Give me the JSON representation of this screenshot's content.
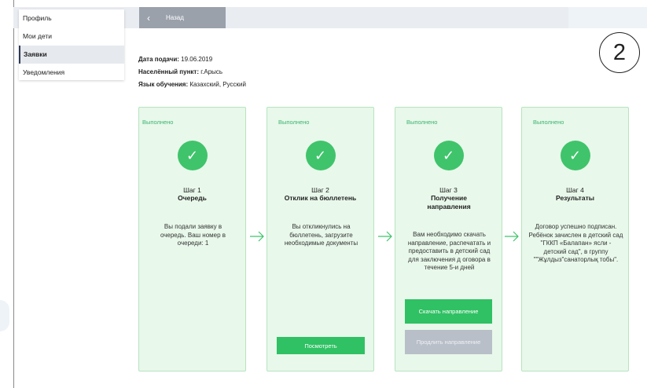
{
  "sidebar": {
    "items": [
      {
        "label": "Профиль"
      },
      {
        "label": "Мои дети"
      },
      {
        "label": "Заявки"
      },
      {
        "label": "Уведомления"
      }
    ]
  },
  "header": {
    "back_label": "Назад",
    "step_badge": "2"
  },
  "application": {
    "date_label": "Дата подачи:",
    "date_value": "19.06.2019",
    "locality_label": "Населённый пункт:",
    "locality_value": "г.Арысь",
    "language_label": "Язык обучения:",
    "language_value": "Казахский, Русский"
  },
  "steps": [
    {
      "status": "Выполнено",
      "number": "Шаг 1",
      "title": "Очередь",
      "description": "Вы подали заявку в очередь. Ваш номер в очереди: 1"
    },
    {
      "status": "Выполнено",
      "number": "Шаг 2",
      "title": "Отклик на бюллетень",
      "description": "Вы откликнулись на бюллетень, загрузите необходимые документы",
      "button": "Посмотреть"
    },
    {
      "status": "Выполнено",
      "number": "Шаг 3",
      "title": "Получение направления",
      "description": "Вам необходимо скачать направление, распечатать и предоставить в детский сад для заключения д оговора в течение 5-и дней",
      "button_primary": "Скачать направление",
      "button_secondary": "Продлить направление"
    },
    {
      "status": "Выполнено",
      "number": "Шаг 4",
      "title": "Результаты",
      "description": "Договор успешно подписан. Ребёнок зачислен в детский сад \"ГККП «Балапан» ясли - детский сад\", в группу \"\"Жұлдыз\"санаторлық тобы\"."
    }
  ],
  "colors": {
    "card_bg": "#e8f8ea",
    "status_green": "#3cb371",
    "button_green": "#2fc163",
    "button_gray": "#b9bfc8"
  },
  "icons": {
    "check": "check-circle-icon",
    "arrow": "arrow-right-icon",
    "back": "chevron-left-icon"
  }
}
